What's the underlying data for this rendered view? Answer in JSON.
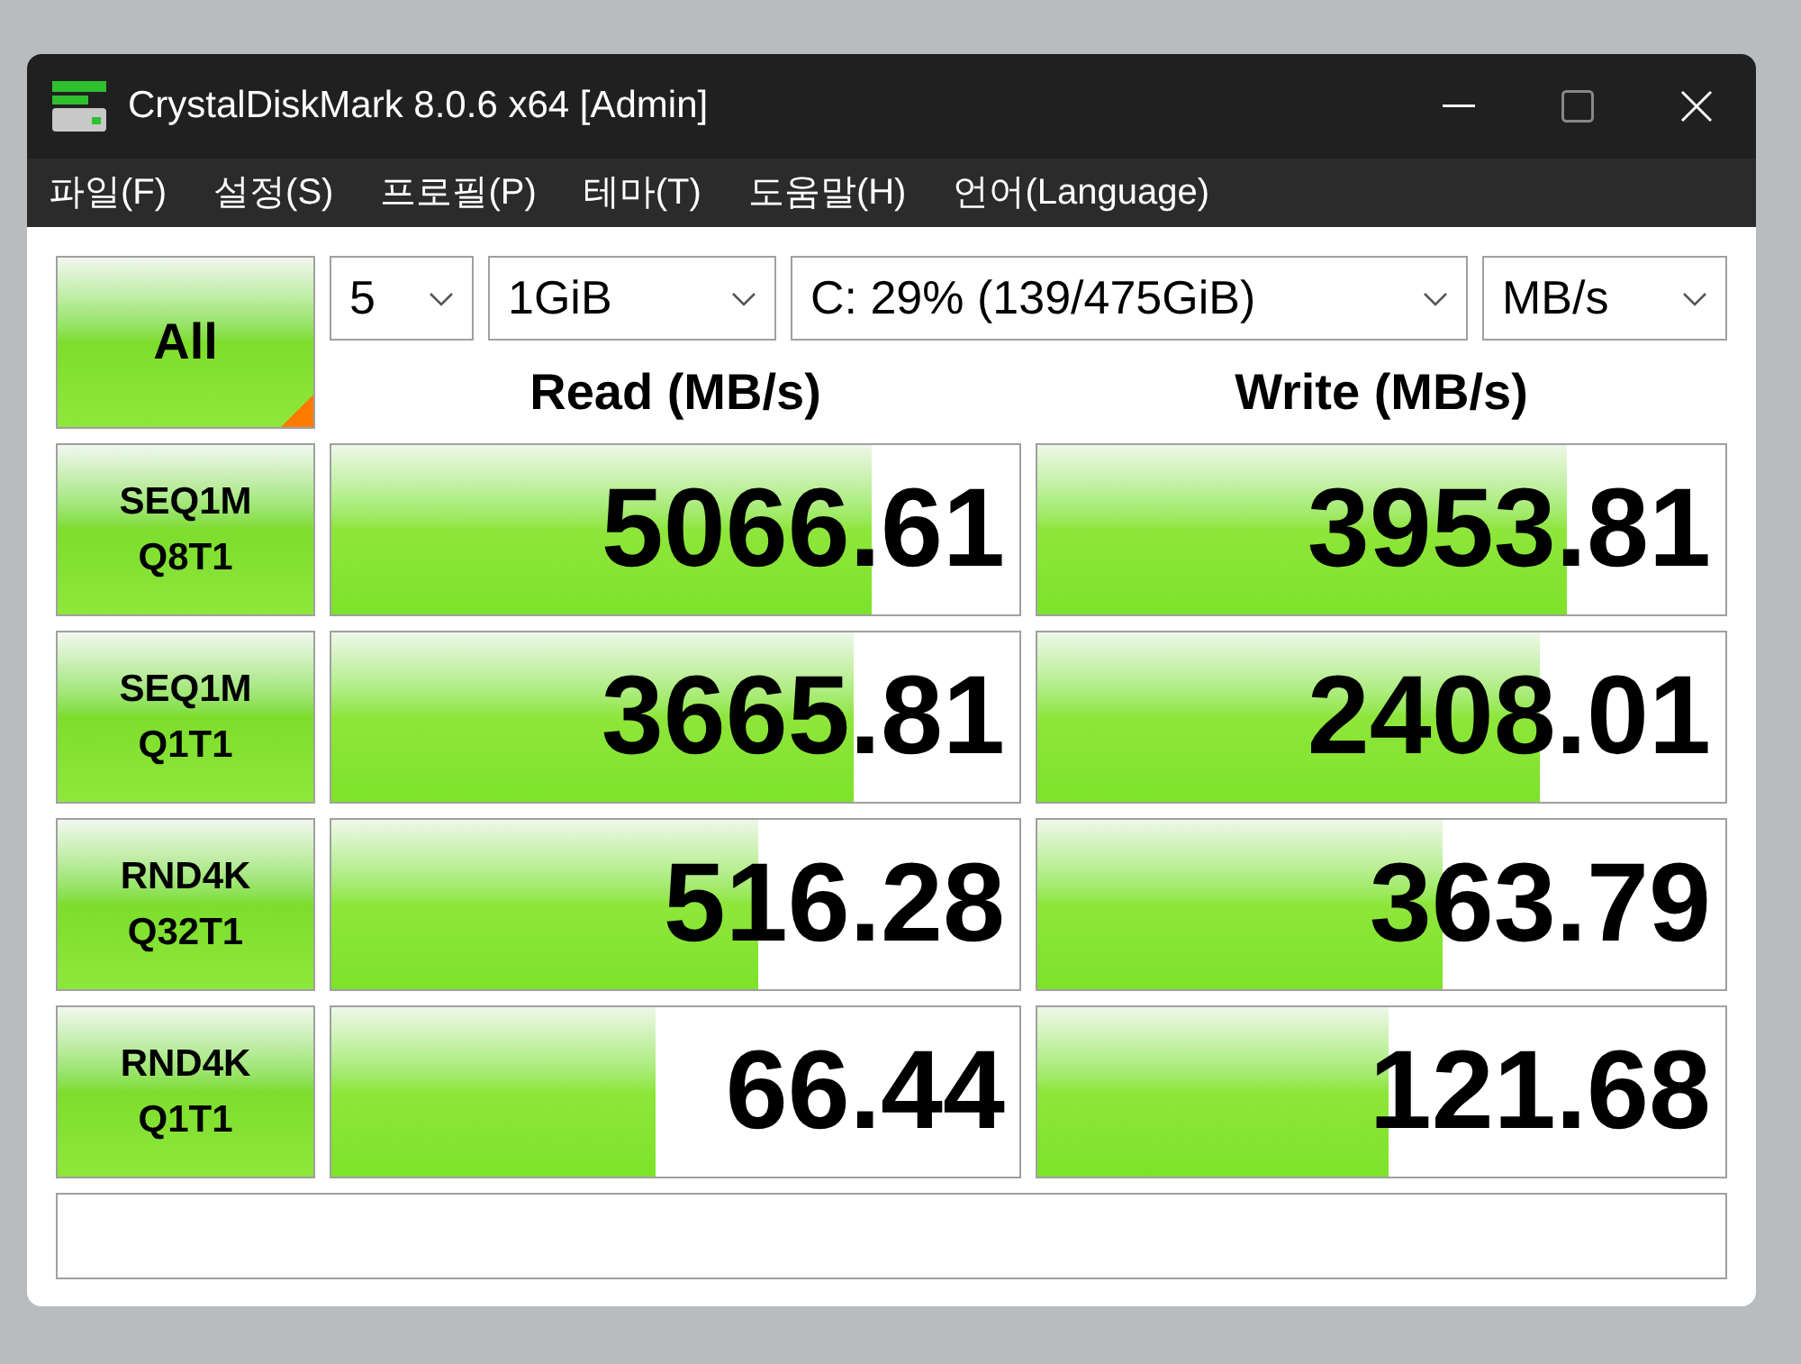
{
  "window": {
    "title": "CrystalDiskMark 8.0.6 x64 [Admin]"
  },
  "menu": [
    "파일(F)",
    "설정(S)",
    "프로필(P)",
    "테마(T)",
    "도움말(H)",
    "언어(Language)"
  ],
  "all_button": {
    "label": "All"
  },
  "selectors": [
    {
      "value": "5"
    },
    {
      "value": "1GiB"
    },
    {
      "value": "C: 29% (139/475GiB)"
    },
    {
      "value": "MB/s"
    }
  ],
  "columns": [
    "Read (MB/s)",
    "Write (MB/s)"
  ],
  "tests": [
    {
      "label": [
        "SEQ1M",
        "Q8T1"
      ],
      "read": {
        "value": "5066.61",
        "level": 0.785
      },
      "write": {
        "value": "3953.81",
        "level": 0.77
      }
    },
    {
      "label": [
        "SEQ1M",
        "Q1T1"
      ],
      "read": {
        "value": "3665.81",
        "level": 0.76
      },
      "write": {
        "value": "2408.01",
        "level": 0.73
      }
    },
    {
      "label": [
        "RND4K",
        "Q32T1"
      ],
      "read": {
        "value": "516.28",
        "level": 0.62
      },
      "write": {
        "value": "363.79",
        "level": 0.59
      }
    },
    {
      "label": [
        "RND4K",
        "Q1T1"
      ],
      "read": {
        "value": "66.44",
        "level": 0.47
      },
      "write": {
        "value": "121.68",
        "level": 0.51
      }
    }
  ]
}
